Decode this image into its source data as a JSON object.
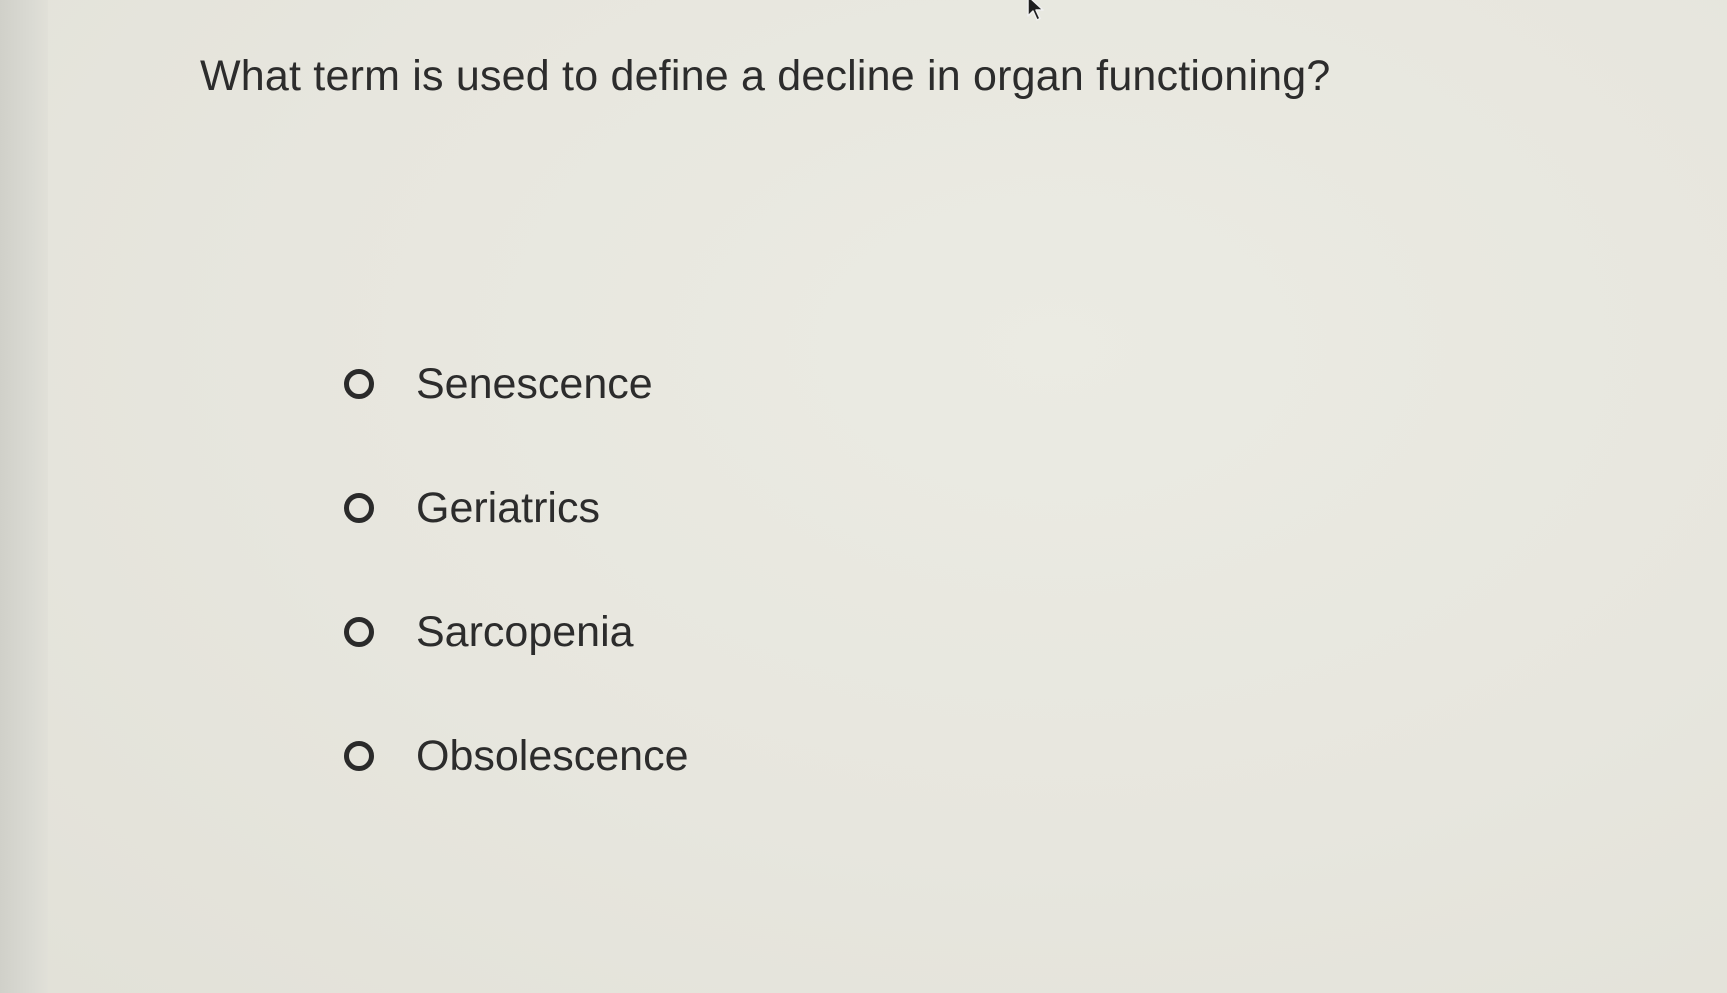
{
  "question": {
    "text": "What term is used to define a decline in organ functioning?"
  },
  "options": [
    {
      "label": "Senescence",
      "selected": false
    },
    {
      "label": "Geriatrics",
      "selected": false
    },
    {
      "label": "Sarcopenia",
      "selected": false
    },
    {
      "label": "Obsolescence",
      "selected": false
    }
  ],
  "icons": {
    "cursor": "mouse-pointer-icon",
    "radio": "radio-unselected-icon"
  },
  "colors": {
    "background": "#e6e5dc",
    "text": "#2c2c2c",
    "radio_border": "#2a2a2a"
  }
}
